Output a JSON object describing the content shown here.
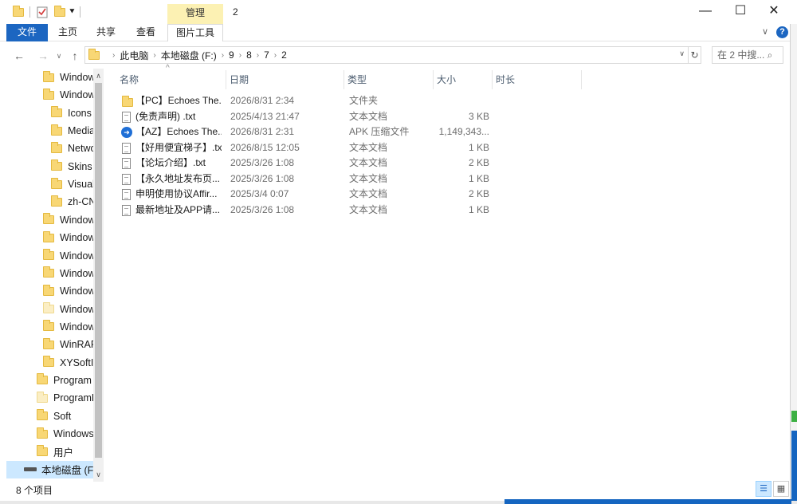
{
  "window": {
    "title": "2",
    "contextual_tab": "管理",
    "minimize": "—",
    "maximize": "☐",
    "close": "✕"
  },
  "ribbon": {
    "tabs": [
      "文件",
      "主页",
      "共享",
      "查看",
      "图片工具"
    ],
    "expand": "∨",
    "help": "?"
  },
  "address": {
    "back": "←",
    "forward": "→",
    "recent": "∨",
    "up": "↑",
    "crumbs": [
      "此电脑",
      "本地磁盘 (F:)",
      "9",
      "8",
      "7",
      "2"
    ],
    "dropdown": "∨",
    "refresh": "↻",
    "search_placeholder": "在 2 中搜... ⌕"
  },
  "nav": {
    "items": [
      {
        "label": "Window",
        "indent": 2
      },
      {
        "label": "Window",
        "indent": 2
      },
      {
        "label": "Icons",
        "indent": 3
      },
      {
        "label": "Media",
        "indent": 3
      },
      {
        "label": "Netwo",
        "indent": 3
      },
      {
        "label": "Skins",
        "indent": 3
      },
      {
        "label": "Visuali",
        "indent": 3
      },
      {
        "label": "zh-CN",
        "indent": 3
      },
      {
        "label": "Window",
        "indent": 2
      },
      {
        "label": "Window",
        "indent": 2
      },
      {
        "label": "Window",
        "indent": 2
      },
      {
        "label": "Window",
        "indent": 2
      },
      {
        "label": "Window",
        "indent": 2
      },
      {
        "label": "Window",
        "indent": 2,
        "pale": true
      },
      {
        "label": "Window",
        "indent": 2
      },
      {
        "label": "WinRAR",
        "indent": 2
      },
      {
        "label": "XYSoftIr",
        "indent": 2
      },
      {
        "label": "Program",
        "indent": 1
      },
      {
        "label": "ProgramD",
        "indent": 1,
        "pale": true
      },
      {
        "label": "Soft",
        "indent": 1
      },
      {
        "label": "Windows",
        "indent": 1
      },
      {
        "label": "用户",
        "indent": 1
      },
      {
        "label": "本地磁盘 (F",
        "indent": 0,
        "drive": true,
        "selected": true
      }
    ]
  },
  "columns": [
    "名称",
    "日期",
    "类型",
    "大小",
    "时长"
  ],
  "sort_arrow": "^",
  "files": [
    {
      "icon": "folder",
      "name": "【PC】Echoes The...",
      "date": "2026/8/31 2:34",
      "type": "文件夹",
      "size": ""
    },
    {
      "icon": "txt",
      "name": "(免责声明) .txt",
      "date": "2025/4/13 21:47",
      "type": "文本文档",
      "size": "3 KB"
    },
    {
      "icon": "apk",
      "name": "【AZ】Echoes The...",
      "date": "2026/8/31 2:31",
      "type": "APK 压缩文件",
      "size": "1,149,343..."
    },
    {
      "icon": "txt",
      "name": "【好用便宜梯子】.txt",
      "date": "2026/8/15 12:05",
      "type": "文本文档",
      "size": "1 KB"
    },
    {
      "icon": "txt",
      "name": "【论坛介绍】.txt",
      "date": "2025/3/26 1:08",
      "type": "文本文档",
      "size": "2 KB"
    },
    {
      "icon": "txt",
      "name": "【永久地址发布页...",
      "date": "2025/3/26 1:08",
      "type": "文本文档",
      "size": "1 KB"
    },
    {
      "icon": "txt",
      "name": "申明使用协议Affir...",
      "date": "2025/3/4 0:07",
      "type": "文本文档",
      "size": "2 KB"
    },
    {
      "icon": "txt",
      "name": "最新地址及APP请...",
      "date": "2025/3/26 1:08",
      "type": "文本文档",
      "size": "1 KB"
    }
  ],
  "status": {
    "item_count": "8 个项目",
    "details_view": "☰",
    "large_icons_view": "▦"
  }
}
